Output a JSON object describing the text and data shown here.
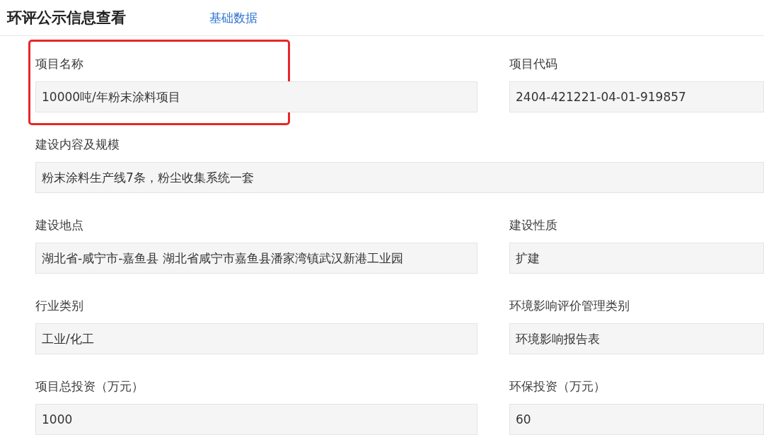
{
  "header": {
    "title": "环评公示信息查看",
    "link": "基础数据"
  },
  "fields": [
    {
      "kind": "half",
      "label": "项目名称",
      "value": "10000吨/年粉末涂料项目",
      "highlighted": true
    },
    {
      "kind": "half",
      "label": "项目代码",
      "value": "2404-421221-04-01-919857",
      "highlighted": false
    },
    {
      "kind": "full",
      "label": "建设内容及规模",
      "value": "粉末涂料生产线7条，粉尘收集系统一套",
      "highlighted": false
    },
    {
      "kind": "half",
      "label": "建设地点",
      "value": "湖北省-咸宁市-嘉鱼县 湖北省咸宁市嘉鱼县潘家湾镇武汉新港工业园",
      "highlighted": false
    },
    {
      "kind": "half",
      "label": "建设性质",
      "value": "扩建",
      "highlighted": false
    },
    {
      "kind": "half",
      "label": "行业类别",
      "value": "工业/化工",
      "highlighted": false
    },
    {
      "kind": "half",
      "label": "环境影响评价管理类别",
      "value": "环境影响报告表",
      "highlighted": false
    },
    {
      "kind": "half",
      "label": "项目总投资（万元）",
      "value": "1000",
      "highlighted": false
    },
    {
      "kind": "half",
      "label": "环保投资（万元）",
      "value": "60",
      "highlighted": false
    }
  ]
}
